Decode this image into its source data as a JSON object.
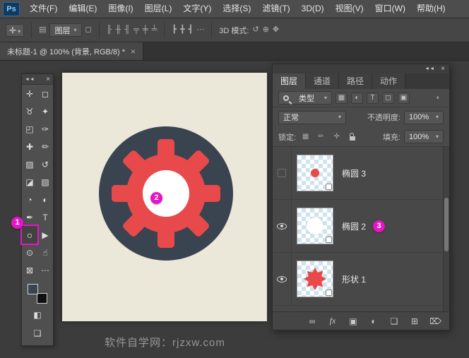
{
  "menubar": {
    "logo": "Ps",
    "items": [
      "文件(F)",
      "编辑(E)",
      "图像(I)",
      "图层(L)",
      "文字(Y)",
      "选择(S)",
      "滤镜(T)",
      "3D(D)",
      "视图(V)",
      "窗口(W)",
      "帮助(H)"
    ]
  },
  "options_bar": {
    "move_tool_icon": "✛",
    "stack_icon": "▤",
    "auto_select_label": "图层",
    "transform_icon": "◻",
    "align_icons": [
      "╟",
      "╫",
      "╢",
      "╤",
      "╪",
      "╧"
    ],
    "distribute_icons": [
      "┣",
      "╋",
      "┫"
    ],
    "more_icon": "⋯",
    "mode_label": "3D 模式:",
    "mode_icons": [
      "↺",
      "⊕",
      "✥"
    ]
  },
  "ui": {
    "caret": "▾"
  },
  "tab_bar": {
    "title": "未标题-1 @ 100% (背景, RGB/8) *",
    "close_icon": "×"
  },
  "toolbox": {
    "collapse_icon": "◄◄",
    "close_icon": "×",
    "badge": "1",
    "quick_mask_icon": "◧",
    "screen_mode_icon": "❏",
    "tools": [
      {
        "name": "move",
        "glyph": "✛"
      },
      {
        "name": "rectangular-marquee",
        "glyph": "◻"
      },
      {
        "name": "lasso",
        "glyph": "♉"
      },
      {
        "name": "quick-selection",
        "glyph": "✦"
      },
      {
        "name": "crop",
        "glyph": "◰"
      },
      {
        "name": "eyedropper",
        "glyph": "✑"
      },
      {
        "name": "healing-brush",
        "glyph": "✚"
      },
      {
        "name": "brush",
        "glyph": "✏"
      },
      {
        "name": "clone-stamp",
        "glyph": "▨"
      },
      {
        "name": "history-brush",
        "glyph": "↺"
      },
      {
        "name": "eraser",
        "glyph": "◪"
      },
      {
        "name": "gradient",
        "glyph": "▧"
      },
      {
        "name": "blur",
        "glyph": "◔"
      },
      {
        "name": "dodge",
        "glyph": "◐"
      },
      {
        "name": "pen",
        "glyph": "✒"
      },
      {
        "name": "type",
        "glyph": "T"
      },
      {
        "name": "ellipse",
        "glyph": "○",
        "highlighted": true
      },
      {
        "name": "path-selection",
        "glyph": "▶"
      },
      {
        "name": "zoom",
        "glyph": "⊙"
      },
      {
        "name": "hand",
        "glyph": "☝"
      },
      {
        "name": "default-colors",
        "glyph": "⊠"
      },
      {
        "name": "edit-toolbar",
        "glyph": "⋯"
      }
    ]
  },
  "canvas": {
    "badge": "2"
  },
  "layers_panel": {
    "collapse_icon": "◄◄",
    "close_icon": "×",
    "tabs": [
      "图层",
      "通道",
      "路径",
      "动作"
    ],
    "filter_label": "类型",
    "filter_icons": [
      "▦",
      "◐",
      "T",
      "◻",
      "▣"
    ],
    "toggle_icon": "◖",
    "blend_mode": "正常",
    "opacity_label": "不透明度:",
    "opacity_value": "100%",
    "lock_label": "锁定:",
    "lock_icons": [
      "▦",
      "✏",
      "✛"
    ],
    "fill_label": "填充:",
    "fill_value": "100%",
    "layers": [
      {
        "name": "椭圆 3",
        "visible": false,
        "thumb": "red-dot"
      },
      {
        "name": "椭圆 2",
        "visible": true,
        "thumb": "white-circle",
        "badge": "3"
      },
      {
        "name": "形状 1",
        "visible": true,
        "thumb": "red-star"
      }
    ],
    "bottom_icons": [
      "∞",
      "fx",
      "▣",
      "◐",
      "❏",
      "⊞",
      "⌦"
    ]
  },
  "watermark": "软件自学网：rjzxw.com",
  "colors": {
    "accent_magenta": "#e416c6",
    "gear_red": "#e84a4b",
    "circle_navy": "#3a4450",
    "canvas_cream": "#ebe7d9",
    "checker_blue": "#cfe3ef"
  }
}
